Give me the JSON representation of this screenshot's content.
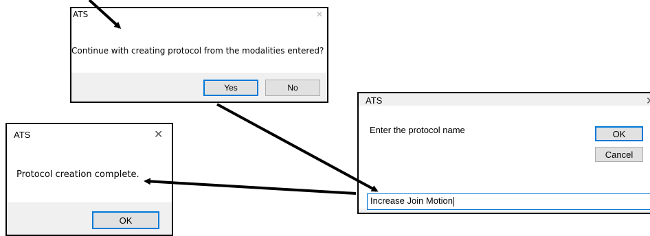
{
  "dialog_confirm": {
    "title": "ATS",
    "message": "Continue with creating protocol from the modalities entered?",
    "yes_label": "Yes",
    "no_label": "No",
    "close_glyph": "✕"
  },
  "dialog_name": {
    "title": "ATS",
    "prompt": "Enter the protocol name",
    "ok_label": "OK",
    "cancel_label": "Cancel",
    "input_value": "Increase Join Motion",
    "close_glyph": "✕"
  },
  "dialog_complete": {
    "title": "ATS",
    "message": "Protocol creation complete.",
    "ok_label": "OK",
    "close_glyph": "✕"
  },
  "colors": {
    "accent_border": "#0078d7",
    "arrow": "#000000",
    "footer_bg": "#f0f0f0"
  }
}
